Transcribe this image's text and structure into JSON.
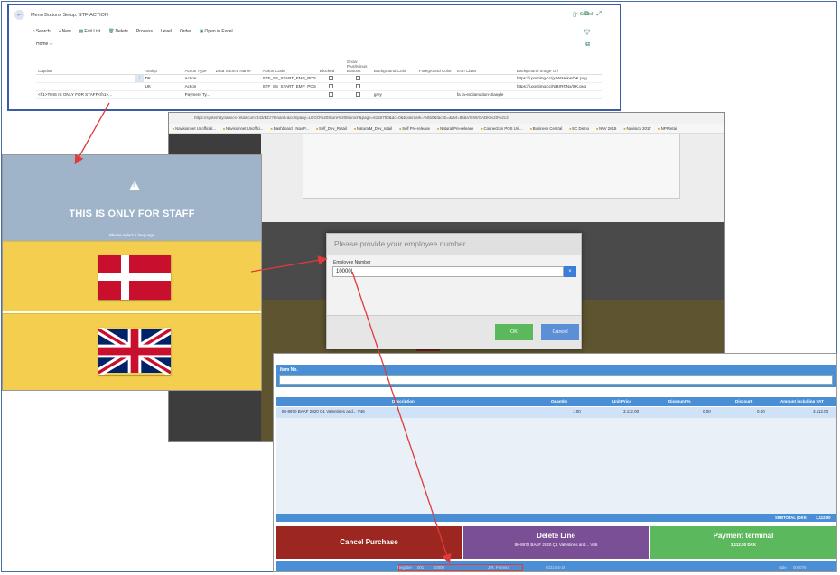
{
  "bc": {
    "title": "Menu Buttons Setup: STF-ACTION",
    "saved": "✓ Saved",
    "actions": [
      {
        "icon": "⌕",
        "label": "Search"
      },
      {
        "icon": "+",
        "label": "New"
      },
      {
        "icon": "▦",
        "label": "Edit List"
      },
      {
        "icon": "🗑",
        "label": "Delete"
      },
      {
        "icon": "",
        "label": "Process"
      },
      {
        "icon": "",
        "label": "Level"
      },
      {
        "icon": "",
        "label": "Order"
      },
      {
        "icon": "▣",
        "label": "Open in Excel"
      }
    ],
    "home": "Home ⌵",
    "columns": [
      "Caption",
      "",
      "Tooltip",
      "Action Type",
      "Data Source Name",
      "Action Code",
      "Blocked",
      "Show Plus/Minus Buttons",
      "Background Color",
      "Foreground Color",
      "Icon Class",
      "Background Image Url"
    ],
    "rows": [
      {
        "mark": "→",
        "caption": "",
        "tooltip": "DK",
        "action_type": "Action",
        "data_source": "",
        "action_code": "STF_SS_START_EMP_POS",
        "bg_color": "",
        "fg_color": "",
        "icon_class": "",
        "image_url": "https://i.postimg.cc/gcWrHxkw/DK.png"
      },
      {
        "mark": "",
        "caption": "",
        "tooltip": "UK",
        "action_type": "Action",
        "data_source": "",
        "action_code": "STF_SS_START_EMP_POS",
        "bg_color": "",
        "fg_color": "",
        "icon_class": "",
        "image_url": "https://i.postimg.cc/NjBrRRNx/UK.png"
      },
      {
        "mark": "",
        "caption": "<h1>THIS IS ONLY FOR STAFF</h1>...",
        "tooltip": "",
        "action_type": "Payment Ty...",
        "data_source": "",
        "action_code": "",
        "bg_color": "grey",
        "fg_color": "",
        "icon_class": "fa fa-exclamation-triangle",
        "image_url": ""
      }
    ]
  },
  "staff": {
    "title": "THIS IS ONLY FOR STAFF",
    "subtitle": "Please select a language"
  },
  "browser": {
    "url": "https://systemdynamics-retail.com:443/BC/?tenant=&company=LEGO%20Store%20Munich&page=6150750&dc=0&bookmark=%5b0&fac2b=&dvf=86&VIEW/GADK%20%2c3",
    "bookmarks": [
      "Navisionnet Unofficial...",
      "Navisionnet Unoffici...",
      "Dashboard - NaviP...",
      "Self_Dev_Retail",
      "NaturalM_Dev_retail",
      "Self Pre-release",
      "Natural Pre-release",
      "Connection POS Uni...",
      "Business Central",
      "BC Demo",
      "NAV 2018",
      "Navision 2017",
      "NP Retail"
    ]
  },
  "dialog": {
    "heading": "Please provide your employee number",
    "label": "Employee Number",
    "value": "10000|",
    "clear_icon": "×",
    "ok": "OK",
    "cancel": "Cancel"
  },
  "pos": {
    "item_label": "Item No.",
    "headers": [
      "Description",
      "Quantity",
      "Unit Price",
      "Discount %",
      "Discount",
      "Amount including VAT"
    ],
    "row": [
      "80-8970 BAAF 2020 Q1 Valentines and... V46",
      "1.00",
      "3,112.00",
      "0.00",
      "0.00",
      "3,112.00"
    ],
    "subtotal_label": "SUBTOTAL (DKK)",
    "subtotal_value": "3,112.00",
    "cancel": "Cancel Purchase",
    "delete": "Delete Line",
    "delete_sub": "80-8970 BAAF 2020 Q1 Valentines and... V46",
    "payment": "Payment terminal",
    "payment_sub": "3,112.00 DKK",
    "status": [
      "Register",
      "001",
      "10000",
      "J.R. Ferreira",
      "2021-04-29",
      "Sale",
      "000076"
    ],
    "colors": {
      "cancel": "#9c2720",
      "delete": "#7b4f96",
      "payment": "#5cb85c",
      "blue": "#4a8fd6"
    }
  }
}
